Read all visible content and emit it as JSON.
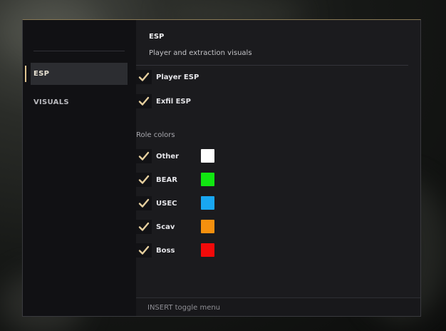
{
  "sidebar": {
    "items": [
      {
        "label": "ESP",
        "active": true
      },
      {
        "label": "VISUALS",
        "active": false
      }
    ]
  },
  "main": {
    "title": "ESP",
    "subtitle": "Player and extraction visuals",
    "toggles": [
      {
        "label": "Player ESP",
        "checked": true
      },
      {
        "label": "Exfil ESP",
        "checked": true
      }
    ],
    "role_colors_label": "Role colors",
    "roles": [
      {
        "label": "Other",
        "checked": true,
        "color": "#ffffff"
      },
      {
        "label": "BEAR",
        "checked": true,
        "color": "#11e611"
      },
      {
        "label": "USEC",
        "checked": true,
        "color": "#19a7f2"
      },
      {
        "label": "Scav",
        "checked": true,
        "color": "#f5900e"
      },
      {
        "label": "Boss",
        "checked": true,
        "color": "#f20a0a"
      }
    ]
  },
  "footer": {
    "hint": "INSERT toggle menu"
  },
  "theme": {
    "accent": "#e0c590",
    "check": "#e6cf9e"
  }
}
